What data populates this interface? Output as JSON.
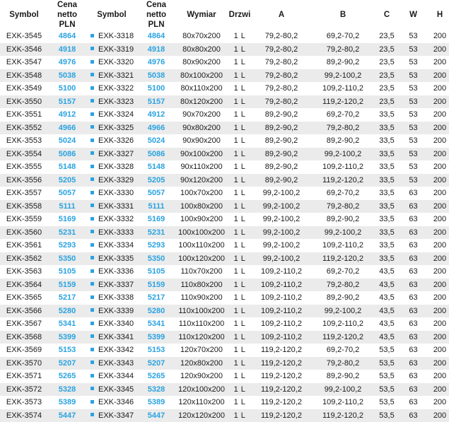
{
  "headers": {
    "symbol": "Symbol",
    "price_line1": "Cena",
    "price_line2": "netto PLN",
    "symbol2": "Symbol",
    "price2_line1": "Cena",
    "price2_line2": "netto PLN",
    "dimension": "Wymiar",
    "doors": "Drzwi",
    "a": "A",
    "b": "B",
    "c": "C",
    "w": "W",
    "h": "H"
  },
  "rows": [
    {
      "symbol": "EXK-3545",
      "price": "4864",
      "symbol2": "EXK-3318",
      "price2": "4864",
      "dimension": "80x70x200",
      "doors": "1 L",
      "a": "79,2-80,2",
      "b": "69,2-70,2",
      "c": "23,5",
      "w": "53",
      "h": "200"
    },
    {
      "symbol": "EXK-3546",
      "price": "4918",
      "symbol2": "EXK-3319",
      "price2": "4918",
      "dimension": "80x80x200",
      "doors": "1 L",
      "a": "79,2-80,2",
      "b": "79,2-80,2",
      "c": "23,5",
      "w": "53",
      "h": "200"
    },
    {
      "symbol": "EXK-3547",
      "price": "4976",
      "symbol2": "EXK-3320",
      "price2": "4976",
      "dimension": "80x90x200",
      "doors": "1 L",
      "a": "79,2-80,2",
      "b": "89,2-90,2",
      "c": "23,5",
      "w": "53",
      "h": "200"
    },
    {
      "symbol": "EXK-3548",
      "price": "5038",
      "symbol2": "EXK-3321",
      "price2": "5038",
      "dimension": "80x100x200",
      "doors": "1 L",
      "a": "79,2-80,2",
      "b": "99,2-100,2",
      "c": "23,5",
      "w": "53",
      "h": "200"
    },
    {
      "symbol": "EXK-3549",
      "price": "5100",
      "symbol2": "EXK-3322",
      "price2": "5100",
      "dimension": "80x110x200",
      "doors": "1 L",
      "a": "79,2-80,2",
      "b": "109,2-110,2",
      "c": "23,5",
      "w": "53",
      "h": "200"
    },
    {
      "symbol": "EXK-3550",
      "price": "5157",
      "symbol2": "EXK-3323",
      "price2": "5157",
      "dimension": "80x120x200",
      "doors": "1 L",
      "a": "79,2-80,2",
      "b": "119,2-120,2",
      "c": "23,5",
      "w": "53",
      "h": "200"
    },
    {
      "symbol": "EXK-3551",
      "price": "4912",
      "symbol2": "EXK-3324",
      "price2": "4912",
      "dimension": "90x70x200",
      "doors": "1 L",
      "a": "89,2-90,2",
      "b": "69,2-70,2",
      "c": "33,5",
      "w": "53",
      "h": "200"
    },
    {
      "symbol": "EXK-3552",
      "price": "4966",
      "symbol2": "EXK-3325",
      "price2": "4966",
      "dimension": "90x80x200",
      "doors": "1 L",
      "a": "89,2-90,2",
      "b": "79,2-80,2",
      "c": "33,5",
      "w": "53",
      "h": "200"
    },
    {
      "symbol": "EXK-3553",
      "price": "5024",
      "symbol2": "EXK-3326",
      "price2": "5024",
      "dimension": "90x90x200",
      "doors": "1 L",
      "a": "89,2-90,2",
      "b": "89,2-90,2",
      "c": "33,5",
      "w": "53",
      "h": "200"
    },
    {
      "symbol": "EXK-3554",
      "price": "5086",
      "symbol2": "EXK-3327",
      "price2": "5086",
      "dimension": "90x100x200",
      "doors": "1 L",
      "a": "89,2-90,2",
      "b": "99,2-100,2",
      "c": "33,5",
      "w": "53",
      "h": "200"
    },
    {
      "symbol": "EXK-3555",
      "price": "5148",
      "symbol2": "EXK-3328",
      "price2": "5148",
      "dimension": "90x110x200",
      "doors": "1 L",
      "a": "89,2-90,2",
      "b": "109,2-110,2",
      "c": "33,5",
      "w": "53",
      "h": "200"
    },
    {
      "symbol": "EXK-3556",
      "price": "5205",
      "symbol2": "EXK-3329",
      "price2": "5205",
      "dimension": "90x120x200",
      "doors": "1 L",
      "a": "89,2-90,2",
      "b": "119,2-120,2",
      "c": "33,5",
      "w": "53",
      "h": "200"
    },
    {
      "symbol": "EXK-3557",
      "price": "5057",
      "symbol2": "EXK-3330",
      "price2": "5057",
      "dimension": "100x70x200",
      "doors": "1 L",
      "a": "99,2-100,2",
      "b": "69,2-70,2",
      "c": "33,5",
      "w": "63",
      "h": "200"
    },
    {
      "symbol": "EXK-3558",
      "price": "5111",
      "symbol2": "EXK-3331",
      "price2": "5111",
      "dimension": "100x80x200",
      "doors": "1 L",
      "a": "99,2-100,2",
      "b": "79,2-80,2",
      "c": "33,5",
      "w": "63",
      "h": "200"
    },
    {
      "symbol": "EXK-3559",
      "price": "5169",
      "symbol2": "EXK-3332",
      "price2": "5169",
      "dimension": "100x90x200",
      "doors": "1 L",
      "a": "99,2-100,2",
      "b": "89,2-90,2",
      "c": "33,5",
      "w": "63",
      "h": "200"
    },
    {
      "symbol": "EXK-3560",
      "price": "5231",
      "symbol2": "EXK-3333",
      "price2": "5231",
      "dimension": "100x100x200",
      "doors": "1 L",
      "a": "99,2-100,2",
      "b": "99,2-100,2",
      "c": "33,5",
      "w": "63",
      "h": "200"
    },
    {
      "symbol": "EXK-3561",
      "price": "5293",
      "symbol2": "EXK-3334",
      "price2": "5293",
      "dimension": "100x110x200",
      "doors": "1 L",
      "a": "99,2-100,2",
      "b": "109,2-110,2",
      "c": "33,5",
      "w": "63",
      "h": "200"
    },
    {
      "symbol": "EXK-3562",
      "price": "5350",
      "symbol2": "EXK-3335",
      "price2": "5350",
      "dimension": "100x120x200",
      "doors": "1 L",
      "a": "99,2-100,2",
      "b": "119,2-120,2",
      "c": "33,5",
      "w": "63",
      "h": "200"
    },
    {
      "symbol": "EXK-3563",
      "price": "5105",
      "symbol2": "EXK-3336",
      "price2": "5105",
      "dimension": "110x70x200",
      "doors": "1 L",
      "a": "109,2-110,2",
      "b": "69,2-70,2",
      "c": "43,5",
      "w": "63",
      "h": "200"
    },
    {
      "symbol": "EXK-3564",
      "price": "5159",
      "symbol2": "EXK-3337",
      "price2": "5159",
      "dimension": "110x80x200",
      "doors": "1 L",
      "a": "109,2-110,2",
      "b": "79,2-80,2",
      "c": "43,5",
      "w": "63",
      "h": "200"
    },
    {
      "symbol": "EXK-3565",
      "price": "5217",
      "symbol2": "EXK-3338",
      "price2": "5217",
      "dimension": "110x90x200",
      "doors": "1 L",
      "a": "109,2-110,2",
      "b": "89,2-90,2",
      "c": "43,5",
      "w": "63",
      "h": "200"
    },
    {
      "symbol": "EXK-3566",
      "price": "5280",
      "symbol2": "EXK-3339",
      "price2": "5280",
      "dimension": "110x100x200",
      "doors": "1 L",
      "a": "109,2-110,2",
      "b": "99,2-100,2",
      "c": "43,5",
      "w": "63",
      "h": "200"
    },
    {
      "symbol": "EXK-3567",
      "price": "5341",
      "symbol2": "EXK-3340",
      "price2": "5341",
      "dimension": "110x110x200",
      "doors": "1 L",
      "a": "109,2-110,2",
      "b": "109,2-110,2",
      "c": "43,5",
      "w": "63",
      "h": "200"
    },
    {
      "symbol": "EXK-3568",
      "price": "5399",
      "symbol2": "EXK-3341",
      "price2": "5399",
      "dimension": "110x120x200",
      "doors": "1 L",
      "a": "109,2-110,2",
      "b": "119,2-120,2",
      "c": "43,5",
      "w": "63",
      "h": "200"
    },
    {
      "symbol": "EXK-3569",
      "price": "5153",
      "symbol2": "EXK-3342",
      "price2": "5153",
      "dimension": "120x70x200",
      "doors": "1 L",
      "a": "119,2-120,2",
      "b": "69,2-70,2",
      "c": "53,5",
      "w": "63",
      "h": "200"
    },
    {
      "symbol": "EXK-3570",
      "price": "5207",
      "symbol2": "EXK-3343",
      "price2": "5207",
      "dimension": "120x80x200",
      "doors": "1 L",
      "a": "119,2-120,2",
      "b": "79,2-80,2",
      "c": "53,5",
      "w": "63",
      "h": "200"
    },
    {
      "symbol": "EXK-3571",
      "price": "5265",
      "symbol2": "EXK-3344",
      "price2": "5265",
      "dimension": "120x90x200",
      "doors": "1 L",
      "a": "119,2-120,2",
      "b": "89,2-90,2",
      "c": "53,5",
      "w": "63",
      "h": "200"
    },
    {
      "symbol": "EXK-3572",
      "price": "5328",
      "symbol2": "EXK-3345",
      "price2": "5328",
      "dimension": "120x100x200",
      "doors": "1 L",
      "a": "119,2-120,2",
      "b": "99,2-100,2",
      "c": "53,5",
      "w": "63",
      "h": "200"
    },
    {
      "symbol": "EXK-3573",
      "price": "5389",
      "symbol2": "EXK-3346",
      "price2": "5389",
      "dimension": "120x110x200",
      "doors": "1 L",
      "a": "119,2-120,2",
      "b": "109,2-110,2",
      "c": "53,5",
      "w": "63",
      "h": "200"
    },
    {
      "symbol": "EXK-3574",
      "price": "5447",
      "symbol2": "EXK-3347",
      "price2": "5447",
      "dimension": "120x120x200",
      "doors": "1 L",
      "a": "119,2-120,2",
      "b": "119,2-120,2",
      "c": "53,5",
      "w": "63",
      "h": "200"
    }
  ],
  "colors": {
    "price_accent": "#2aa3e0",
    "stripe": "#ebebeb",
    "text": "#1a1a1a"
  }
}
